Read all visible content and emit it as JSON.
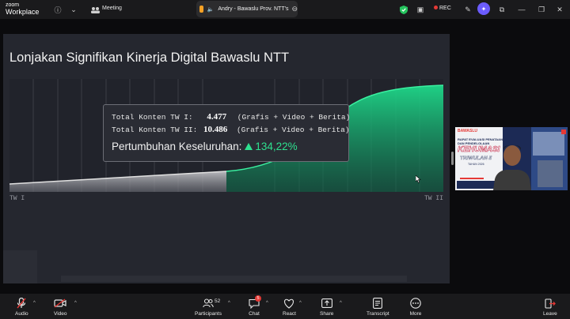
{
  "app": {
    "logo_line1": "zoom",
    "logo_line2": "Workplace",
    "meeting_label": "Meeting",
    "share_tab_label": "Andry - Bawaslu Prov. NTT's",
    "rec_label": "REC"
  },
  "slide": {
    "title": "Lonjakan Signifikan Kinerja Digital Bawaslu NTT",
    "x_start_label": "TW I",
    "x_end_label": "TW II",
    "info": {
      "row1_label": "Total Konten TW I:",
      "row1_value": "4.477",
      "row1_note": "(Grafis + Video + Berita)",
      "row2_label": "Total Konten TW II:",
      "row2_value": "10.486",
      "row2_note": "(Grafis + Video + Berita)",
      "growth_label": "Pertumbuhan Keseluruhan:",
      "growth_value": "134,22%"
    }
  },
  "video": {
    "org": "BAWASLU",
    "line1": "RAPAT EVALUASI PENATAAN",
    "line2": "DAN PENDELOLAAN",
    "big": "KEHUMASI",
    "sub": "TRIWULAN II",
    "year": "TAHUN 2026"
  },
  "toolbar": {
    "audio": "Audio",
    "video": "Video",
    "participants": "Participants",
    "participants_count": "52",
    "chat": "Chat",
    "chat_badge": "5",
    "react": "React",
    "share": "Share",
    "transcript": "Transcript",
    "more": "More",
    "leave": "Leave"
  },
  "colors": {
    "accent_green": "#2ee08f",
    "rec_red": "#e53935",
    "leave_red": "#e53935",
    "shield_green": "#25c55e"
  }
}
